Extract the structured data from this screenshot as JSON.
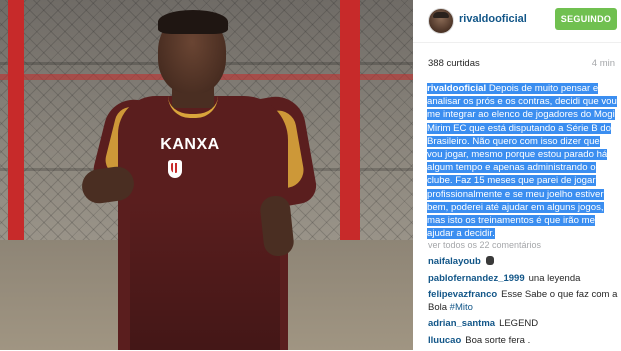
{
  "post": {
    "username": "rivaldooficial",
    "follow_label": "SEGUINDO",
    "likes": "388 curtidas",
    "time": "4 min",
    "caption_user": "rivaldooficial",
    "caption_text": "Depois de muito pensar e analisar os prós e os contras, decidi que vou me integrar ao elenco de jogadores do Mogi Mirim EC que está disputando a Série B do Brasileiro. Não quero com isso dizer que vou jogar, mesmo porque estou parado há algum tempo e apenas administrando o clube. Faz 15 meses que parei de jogar profissionalmente e se meu joelho estiver bem, poderei até ajudar em alguns jogos, mas isto os treinamentos é que irão me ajudar a decidir.",
    "view_all": "ver todos os 22 comentários"
  },
  "comments": [
    {
      "user": "naifalayoub",
      "text": "",
      "emoji": "fist-emoji"
    },
    {
      "user": "pablofernandez_1999",
      "text": "una leyenda"
    },
    {
      "user": "felipevazfranco",
      "text": "Esse Sabe o que faz com a Bola",
      "hashtag": "#Mito"
    },
    {
      "user": "adrian_santma",
      "text": "LEGEND"
    },
    {
      "user": "lluucao",
      "text": "Boa sorte fera ."
    }
  ],
  "photo": {
    "sponsor_text": "KANXA",
    "colors": {
      "shirt": "#5a1e1e",
      "stripe": "#d9a53b",
      "post": "#c72a2a"
    }
  },
  "colors": {
    "follow_button": "#70c050",
    "username": "#125688",
    "selection": "#3b8ef0",
    "muted": "#a5a7aa"
  }
}
